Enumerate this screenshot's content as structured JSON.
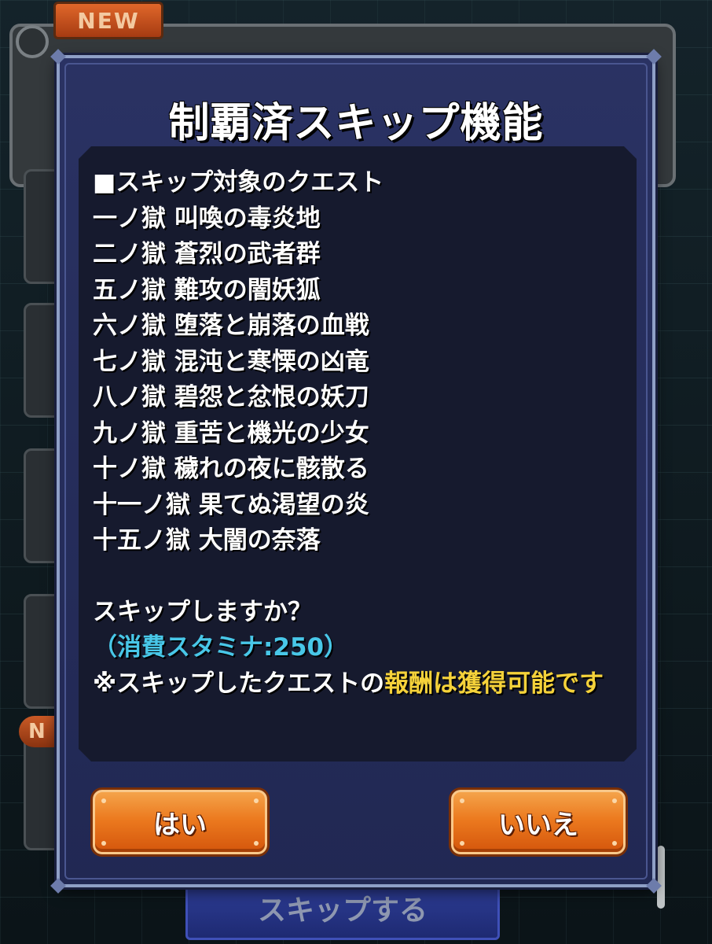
{
  "background": {
    "new_badge": "NEW",
    "new_badge_small": "N",
    "skip_button_label": "スキップする"
  },
  "dialog": {
    "title": "制覇済スキップ機能",
    "section_header": "■スキップ対象のクエスト",
    "quests": [
      "一ノ獄 叫喚の毒炎地",
      "二ノ獄 蒼烈の武者群",
      "五ノ獄 難攻の闇妖狐",
      "六ノ獄 堕落と崩落の血戦",
      "七ノ獄 混沌と寒慄の凶竜",
      "八ノ獄 碧怨と忿恨の妖刀",
      "九ノ獄 重苦と機光の少女",
      "十ノ獄 穢れの夜に骸散る",
      "十一ノ獄 果てぬ渇望の炎",
      "十五ノ獄 大闇の奈落"
    ],
    "question": "スキップしますか？",
    "stamina_cost": "（消費スタミナ:250）",
    "note_prefix": "※スキップしたクエストの",
    "note_highlight": "報酬は獲得可能です",
    "yes_label": "はい",
    "no_label": "いいえ"
  },
  "colors": {
    "highlight_yellow": "#f5d23a",
    "stamina_cyan": "#48c7e8",
    "button_orange": "#ec7a1f",
    "dialog_navy": "#242b5a"
  }
}
